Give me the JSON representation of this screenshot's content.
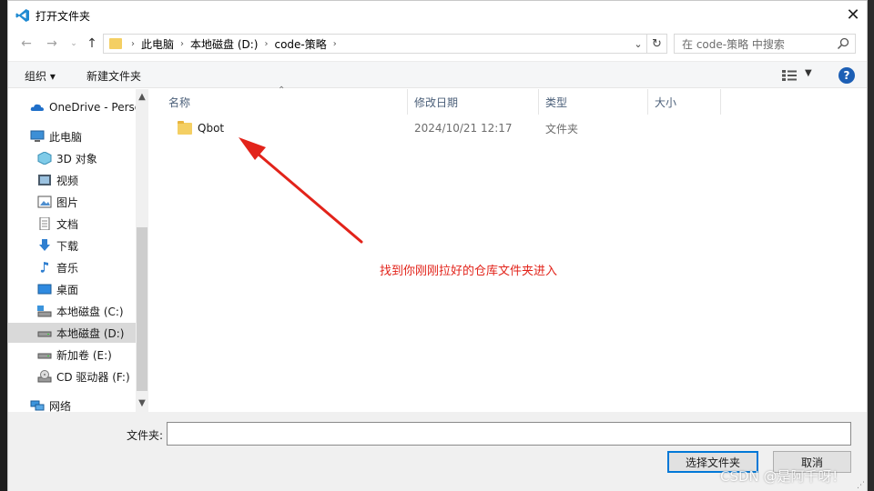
{
  "window": {
    "title": "打开文件夹"
  },
  "address": {
    "crumbs": [
      "此电脑",
      "本地磁盘 (D:)",
      "code-策略"
    ],
    "search_placeholder": "在 code-策略 中搜索"
  },
  "toolbar": {
    "organize_label": "组织 ▾",
    "new_folder_label": "新建文件夹",
    "help_label": "?"
  },
  "sidebar": {
    "items": [
      {
        "label": "OneDrive - Personal",
        "icon": "onedrive-icon",
        "indent": 1
      },
      {
        "label": "此电脑",
        "icon": "computer-icon",
        "indent": 1
      },
      {
        "label": "3D 对象",
        "icon": "3d-objects-icon",
        "indent": 2
      },
      {
        "label": "视频",
        "icon": "video-icon",
        "indent": 2
      },
      {
        "label": "图片",
        "icon": "pictures-icon",
        "indent": 2
      },
      {
        "label": "文档",
        "icon": "documents-icon",
        "indent": 2
      },
      {
        "label": "下载",
        "icon": "download-icon",
        "indent": 2
      },
      {
        "label": "音乐",
        "icon": "music-icon",
        "indent": 2
      },
      {
        "label": "桌面",
        "icon": "desktop-icon",
        "indent": 2
      },
      {
        "label": "本地磁盘 (C:)",
        "icon": "drive-c-icon",
        "indent": 2
      },
      {
        "label": "本地磁盘 (D:)",
        "icon": "drive-icon",
        "indent": 2,
        "selected": true
      },
      {
        "label": "新加卷 (E:)",
        "icon": "drive-icon",
        "indent": 2
      },
      {
        "label": "CD 驱动器 (F:)",
        "icon": "cd-drive-icon",
        "indent": 2
      },
      {
        "label": "网络",
        "icon": "network-icon",
        "indent": 1
      }
    ]
  },
  "columns": {
    "name": "名称",
    "modified": "修改日期",
    "type": "类型",
    "size": "大小"
  },
  "files": [
    {
      "name": "Qbot",
      "modified": "2024/10/21 12:17",
      "type": "文件夹",
      "size": ""
    }
  ],
  "annotation": {
    "text": "找到你刚刚拉好的仓库文件夹进入",
    "color": "#e2231a"
  },
  "bottom": {
    "folder_label": "文件夹:",
    "folder_value": "",
    "select_label": "选择文件夹",
    "cancel_label": "取消"
  },
  "watermark": "CSDN @是阿千呀！",
  "colors": {
    "accent": "#0078d7",
    "folder": "#f4cf63",
    "selected": "#d9d9d9"
  }
}
